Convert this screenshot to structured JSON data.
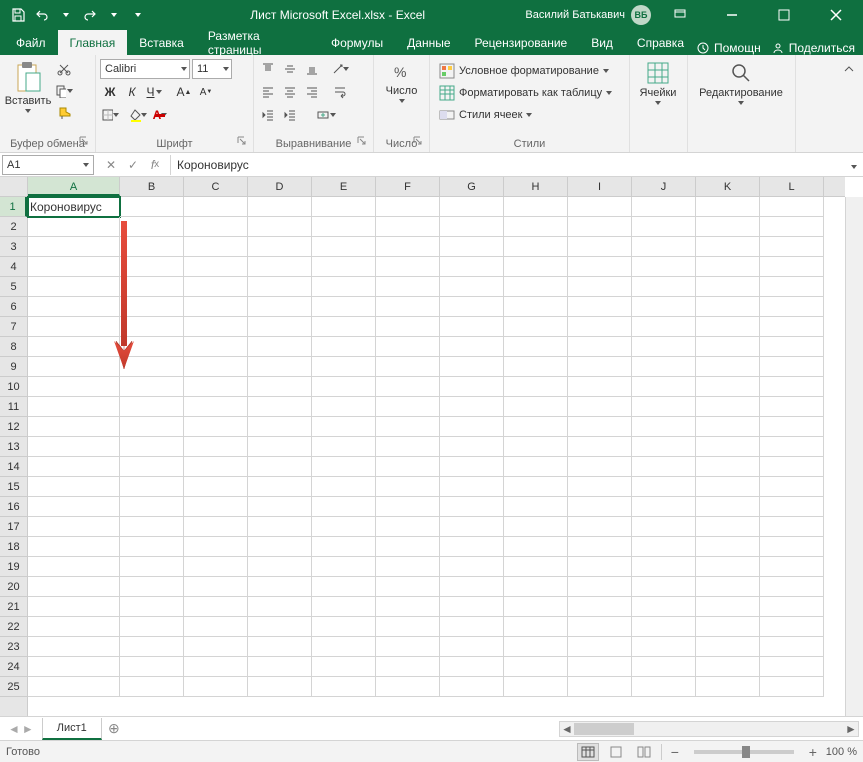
{
  "titlebar": {
    "doc_title": "Лист Microsoft Excel.xlsx  -  Excel",
    "user_name": "Василий Батькавич",
    "user_initials": "ВБ"
  },
  "tabs": {
    "file": "Файл",
    "home": "Главная",
    "insert": "Вставка",
    "pagelayout": "Разметка страницы",
    "formulas": "Формулы",
    "data": "Данные",
    "review": "Рецензирование",
    "view": "Вид",
    "help": "Справка",
    "tell_me": "Помощн",
    "share": "Поделиться"
  },
  "ribbon": {
    "clipboard": {
      "paste": "Вставить",
      "label": "Буфер обмена"
    },
    "font": {
      "name": "Calibri",
      "size": "11",
      "bold": "Ж",
      "italic": "К",
      "underline": "Ч",
      "label": "Шрифт"
    },
    "alignment": {
      "label": "Выравнивание"
    },
    "number": {
      "btn": "Число",
      "label": "Число"
    },
    "styles": {
      "cond": "Условное форматирование",
      "table": "Форматировать как таблицу",
      "cell": "Стили ячеек",
      "label": "Стили"
    },
    "cells": {
      "btn": "Ячейки",
      "label": ""
    },
    "editing": {
      "btn": "Редактирование",
      "label": ""
    }
  },
  "namebox": "A1",
  "formula": "Короновирус",
  "columns": [
    "A",
    "B",
    "C",
    "D",
    "E",
    "F",
    "G",
    "H",
    "I",
    "J",
    "K",
    "L"
  ],
  "rows": [
    "1",
    "2",
    "3",
    "4",
    "5",
    "6",
    "7",
    "8",
    "9",
    "10",
    "11",
    "12",
    "13",
    "14",
    "15",
    "16",
    "17",
    "18",
    "19",
    "20",
    "21",
    "22",
    "23",
    "24",
    "25"
  ],
  "cell_A1": "Короновирус",
  "sheet": {
    "name": "Лист1"
  },
  "status": {
    "ready": "Готово",
    "zoom": "100 %"
  }
}
